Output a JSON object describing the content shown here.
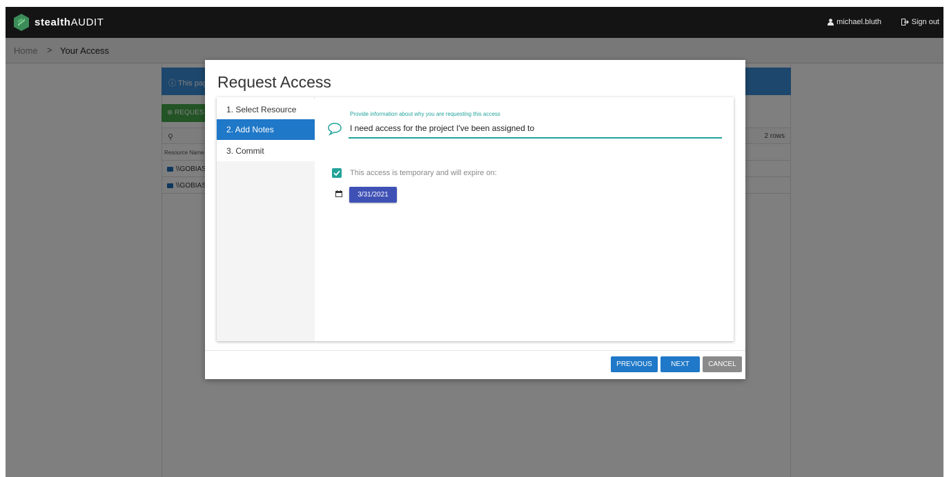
{
  "header": {
    "logo_bold": "stealth",
    "logo_light": "AUDIT",
    "user_name": "michael.bluth",
    "signout_label": "Sign out"
  },
  "breadcrumb": {
    "home": "Home",
    "separator": ">",
    "current": "Your Access"
  },
  "background": {
    "banner_text": "This pag",
    "request_button": "REQUES",
    "rows_count": "2 rows",
    "column_header": "Resource Name",
    "rows": [
      "\\\\GOBIAS",
      "\\\\GOBIAS"
    ]
  },
  "modal": {
    "title": "Request Access",
    "steps": [
      {
        "label": "1. Select Resource"
      },
      {
        "label": "2. Add Notes"
      },
      {
        "label": "3. Commit"
      }
    ],
    "notes_label": "Provide information about why you are requesting this access",
    "notes_value": "I need access for the project I've been assigned to",
    "temporary_checked": true,
    "temporary_label": "This access is temporary and will expire on:",
    "expire_date": "3/31/2021",
    "buttons": {
      "previous": "PREVIOUS",
      "next": "NEXT",
      "cancel": "CANCEL"
    }
  },
  "colors": {
    "primary": "#1f78c8",
    "teal": "#22a39a",
    "date_button": "#3f51b5",
    "cancel": "#8a8a8a"
  },
  "icons": [
    "logo-icon",
    "user-icon",
    "sign-out-icon",
    "comment-icon",
    "check-icon",
    "calendar-icon",
    "folder-icon",
    "search-icon",
    "plus-circle-icon",
    "info-icon"
  ]
}
